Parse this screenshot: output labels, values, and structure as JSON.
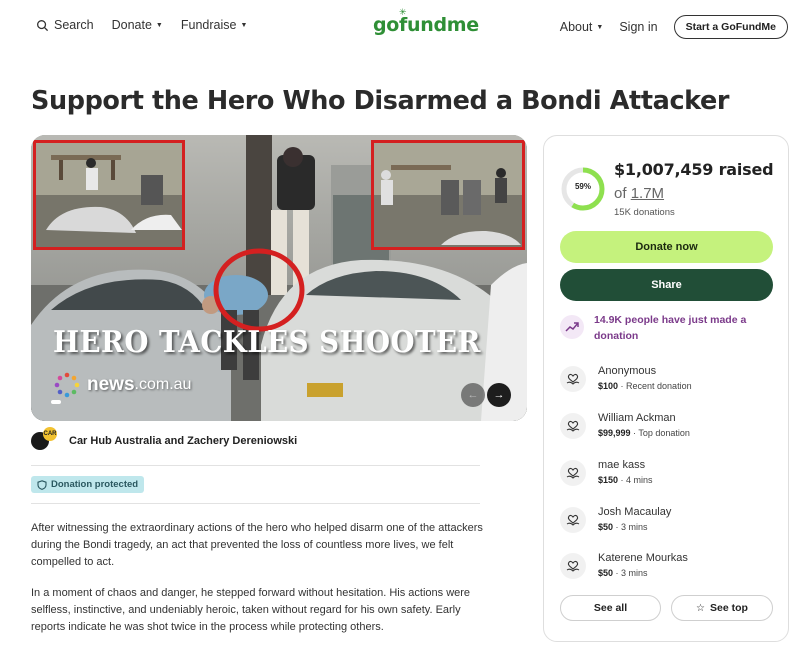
{
  "header": {
    "search_label": "Search",
    "donate_label": "Donate",
    "fundraise_label": "Fundraise",
    "logo_text": "gofundme",
    "about_label": "About",
    "signin_label": "Sign in",
    "start_label": "Start a GoFundMe"
  },
  "campaign": {
    "title": "Support the Hero Who Disarmed a Bondi Attacker",
    "image_caption": "HERO TACKLES SHOOTER",
    "news_brand_bold": "news",
    "news_brand_normal": ".com.au",
    "organizer": "Car Hub Australia and Zachery Dereniowski",
    "organizer_badge": "CAR",
    "protected_label": "Donation protected",
    "story": [
      "After witnessing the extraordinary actions of the hero who helped disarm one of the attackers during the Bondi tragedy, an act that prevented the loss of countless more lives, we felt compelled to act.",
      "In a moment of chaos and danger, he stepped forward without hesitation. His actions were selfless, instinctive, and undeniably heroic, taken without regard for his own safety. Early reports indicate he was shot twice in the process while protecting others."
    ]
  },
  "card": {
    "progress": 0.59,
    "progress_label": "59%",
    "raised": "$1,007,459 raised",
    "of_prefix": "of ",
    "goal": "1.7M",
    "donations_count": "15K donations",
    "donate_button": "Donate now",
    "share_button": "Share",
    "trend_text": "14.9K people have just made a donation",
    "donors": [
      {
        "name": "Anonymous",
        "amount": "$100",
        "note": " · Recent donation"
      },
      {
        "name": "William Ackman",
        "amount": "$99,999",
        "note": " · Top donation"
      },
      {
        "name": "mae kass",
        "amount": "$150",
        "note": " · 4 mins"
      },
      {
        "name": "Josh Macaulay",
        "amount": "$50",
        "note": " · 3 mins"
      },
      {
        "name": "Katerene Mourkas",
        "amount": "$50",
        "note": " · 3 mins"
      }
    ],
    "see_all": "See all",
    "see_top": "See top"
  },
  "colors": {
    "brand_green": "#2f8f36",
    "donate_button": "#c5f27d",
    "share_button": "#214e37",
    "progress_ring": "#8ee04f",
    "trend_purple": "#7b3a8a",
    "protected_bg": "#bfe7ec",
    "highlight_red": "#d42020"
  }
}
